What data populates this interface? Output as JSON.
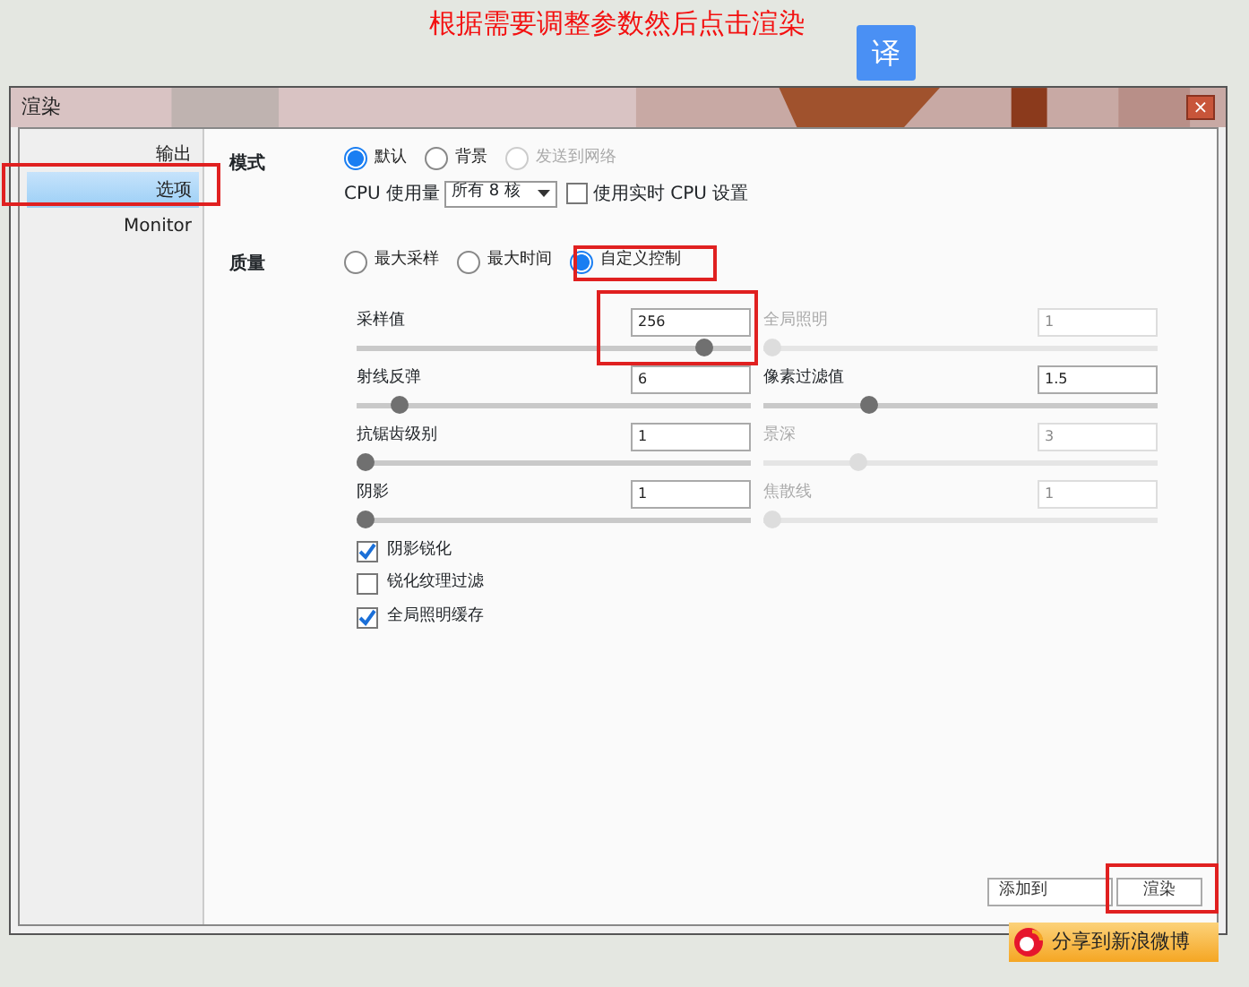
{
  "caption": "根据需要调整参数然后点击渲染",
  "translate_button": "译",
  "window": {
    "title": "渲染",
    "close": "×"
  },
  "sidebar": {
    "items": [
      {
        "label": "输出",
        "selected": false
      },
      {
        "label": "选项",
        "selected": true
      },
      {
        "label": "Monitor",
        "selected": false
      }
    ]
  },
  "mode": {
    "label": "模式",
    "options": [
      {
        "label": "默认",
        "selected": true,
        "disabled": false
      },
      {
        "label": "背景",
        "selected": false,
        "disabled": false
      },
      {
        "label": "发送到网络",
        "selected": false,
        "disabled": true
      }
    ],
    "cpu_label": "CPU 使用量",
    "cpu_value": "所有 8 核",
    "realtime": {
      "label": "使用实时 CPU 设置",
      "checked": false
    }
  },
  "quality": {
    "label": "质量",
    "options": [
      {
        "label": "最大采样",
        "selected": false
      },
      {
        "label": "最大时间",
        "selected": false
      },
      {
        "label": "自定义控制",
        "selected": true
      }
    ],
    "params": [
      {
        "label": "采样值",
        "value": "256",
        "level": 0.88,
        "disabled": false
      },
      {
        "label": "全局照明",
        "value": "1",
        "level": 0,
        "disabled": true
      },
      {
        "label": "射线反弹",
        "value": "6",
        "level": 0.11,
        "disabled": false
      },
      {
        "label": "像素过滤值",
        "value": "1.5",
        "level": 0.27,
        "disabled": false
      },
      {
        "label": "抗锯齿级别",
        "value": "1",
        "level": 0,
        "disabled": false
      },
      {
        "label": "景深",
        "value": "3",
        "level": 0.24,
        "disabled": true
      },
      {
        "label": "阴影",
        "value": "1",
        "level": 0,
        "disabled": false
      },
      {
        "label": "焦散线",
        "value": "1",
        "level": 0,
        "disabled": true
      }
    ],
    "checks": [
      {
        "label": "阴影锐化",
        "checked": true
      },
      {
        "label": "锐化纹理过滤",
        "checked": false
      },
      {
        "label": "全局照明缓存",
        "checked": true
      }
    ]
  },
  "buttons": [
    "添加到",
    "渲染"
  ],
  "share_popup": "分享到新浪微博"
}
